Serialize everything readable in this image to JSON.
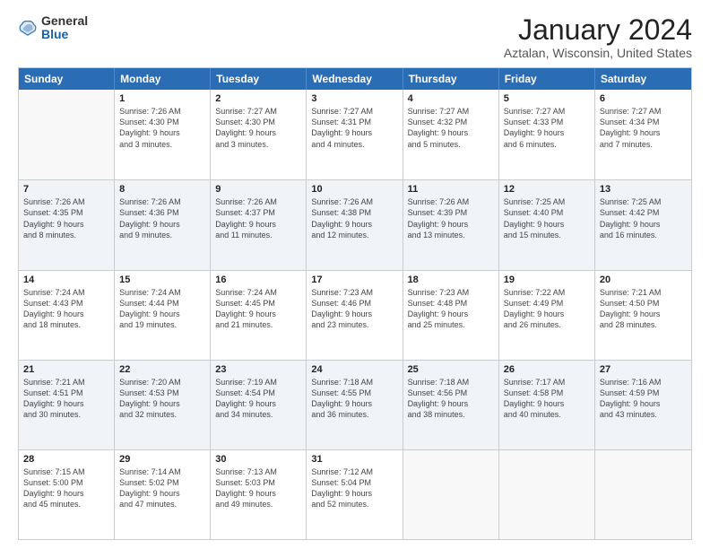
{
  "logo": {
    "general": "General",
    "blue": "Blue"
  },
  "title": {
    "month": "January 2024",
    "location": "Aztalan, Wisconsin, United States"
  },
  "calendar": {
    "headers": [
      "Sunday",
      "Monday",
      "Tuesday",
      "Wednesday",
      "Thursday",
      "Friday",
      "Saturday"
    ],
    "rows": [
      [
        {
          "day": "",
          "info": ""
        },
        {
          "day": "1",
          "info": "Sunrise: 7:26 AM\nSunset: 4:30 PM\nDaylight: 9 hours\nand 3 minutes."
        },
        {
          "day": "2",
          "info": "Sunrise: 7:27 AM\nSunset: 4:30 PM\nDaylight: 9 hours\nand 3 minutes."
        },
        {
          "day": "3",
          "info": "Sunrise: 7:27 AM\nSunset: 4:31 PM\nDaylight: 9 hours\nand 4 minutes."
        },
        {
          "day": "4",
          "info": "Sunrise: 7:27 AM\nSunset: 4:32 PM\nDaylight: 9 hours\nand 5 minutes."
        },
        {
          "day": "5",
          "info": "Sunrise: 7:27 AM\nSunset: 4:33 PM\nDaylight: 9 hours\nand 6 minutes."
        },
        {
          "day": "6",
          "info": "Sunrise: 7:27 AM\nSunset: 4:34 PM\nDaylight: 9 hours\nand 7 minutes."
        }
      ],
      [
        {
          "day": "7",
          "info": "Sunrise: 7:26 AM\nSunset: 4:35 PM\nDaylight: 9 hours\nand 8 minutes."
        },
        {
          "day": "8",
          "info": "Sunrise: 7:26 AM\nSunset: 4:36 PM\nDaylight: 9 hours\nand 9 minutes."
        },
        {
          "day": "9",
          "info": "Sunrise: 7:26 AM\nSunset: 4:37 PM\nDaylight: 9 hours\nand 11 minutes."
        },
        {
          "day": "10",
          "info": "Sunrise: 7:26 AM\nSunset: 4:38 PM\nDaylight: 9 hours\nand 12 minutes."
        },
        {
          "day": "11",
          "info": "Sunrise: 7:26 AM\nSunset: 4:39 PM\nDaylight: 9 hours\nand 13 minutes."
        },
        {
          "day": "12",
          "info": "Sunrise: 7:25 AM\nSunset: 4:40 PM\nDaylight: 9 hours\nand 15 minutes."
        },
        {
          "day": "13",
          "info": "Sunrise: 7:25 AM\nSunset: 4:42 PM\nDaylight: 9 hours\nand 16 minutes."
        }
      ],
      [
        {
          "day": "14",
          "info": "Sunrise: 7:24 AM\nSunset: 4:43 PM\nDaylight: 9 hours\nand 18 minutes."
        },
        {
          "day": "15",
          "info": "Sunrise: 7:24 AM\nSunset: 4:44 PM\nDaylight: 9 hours\nand 19 minutes."
        },
        {
          "day": "16",
          "info": "Sunrise: 7:24 AM\nSunset: 4:45 PM\nDaylight: 9 hours\nand 21 minutes."
        },
        {
          "day": "17",
          "info": "Sunrise: 7:23 AM\nSunset: 4:46 PM\nDaylight: 9 hours\nand 23 minutes."
        },
        {
          "day": "18",
          "info": "Sunrise: 7:23 AM\nSunset: 4:48 PM\nDaylight: 9 hours\nand 25 minutes."
        },
        {
          "day": "19",
          "info": "Sunrise: 7:22 AM\nSunset: 4:49 PM\nDaylight: 9 hours\nand 26 minutes."
        },
        {
          "day": "20",
          "info": "Sunrise: 7:21 AM\nSunset: 4:50 PM\nDaylight: 9 hours\nand 28 minutes."
        }
      ],
      [
        {
          "day": "21",
          "info": "Sunrise: 7:21 AM\nSunset: 4:51 PM\nDaylight: 9 hours\nand 30 minutes."
        },
        {
          "day": "22",
          "info": "Sunrise: 7:20 AM\nSunset: 4:53 PM\nDaylight: 9 hours\nand 32 minutes."
        },
        {
          "day": "23",
          "info": "Sunrise: 7:19 AM\nSunset: 4:54 PM\nDaylight: 9 hours\nand 34 minutes."
        },
        {
          "day": "24",
          "info": "Sunrise: 7:18 AM\nSunset: 4:55 PM\nDaylight: 9 hours\nand 36 minutes."
        },
        {
          "day": "25",
          "info": "Sunrise: 7:18 AM\nSunset: 4:56 PM\nDaylight: 9 hours\nand 38 minutes."
        },
        {
          "day": "26",
          "info": "Sunrise: 7:17 AM\nSunset: 4:58 PM\nDaylight: 9 hours\nand 40 minutes."
        },
        {
          "day": "27",
          "info": "Sunrise: 7:16 AM\nSunset: 4:59 PM\nDaylight: 9 hours\nand 43 minutes."
        }
      ],
      [
        {
          "day": "28",
          "info": "Sunrise: 7:15 AM\nSunset: 5:00 PM\nDaylight: 9 hours\nand 45 minutes."
        },
        {
          "day": "29",
          "info": "Sunrise: 7:14 AM\nSunset: 5:02 PM\nDaylight: 9 hours\nand 47 minutes."
        },
        {
          "day": "30",
          "info": "Sunrise: 7:13 AM\nSunset: 5:03 PM\nDaylight: 9 hours\nand 49 minutes."
        },
        {
          "day": "31",
          "info": "Sunrise: 7:12 AM\nSunset: 5:04 PM\nDaylight: 9 hours\nand 52 minutes."
        },
        {
          "day": "",
          "info": ""
        },
        {
          "day": "",
          "info": ""
        },
        {
          "day": "",
          "info": ""
        }
      ]
    ]
  }
}
